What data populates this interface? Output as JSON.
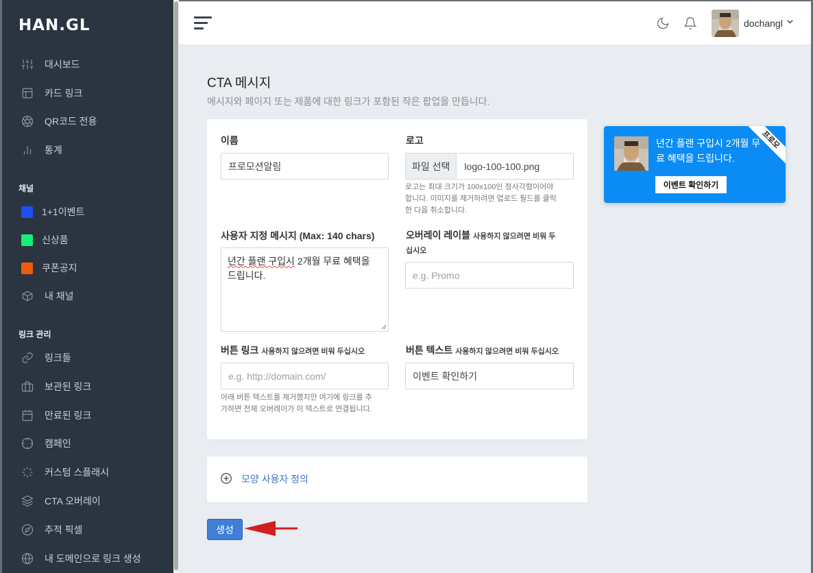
{
  "brand": "HAN.GL",
  "sidebar": {
    "items": [
      {
        "label": "대시보드",
        "icon": "sliders-icon"
      },
      {
        "label": "카드 링크",
        "icon": "layout-icon"
      },
      {
        "label": "QR코드 전용",
        "icon": "aperture-icon"
      },
      {
        "label": "통계",
        "icon": "bar-chart-icon"
      }
    ],
    "channels_title": "채널",
    "channels": [
      {
        "label": "1+1이벤트",
        "color": "#1e4ff5"
      },
      {
        "label": "신상품",
        "color": "#14f07a"
      },
      {
        "label": "쿠폰공지",
        "color": "#f05a0c"
      },
      {
        "label": "내 채널",
        "icon": "box-icon"
      }
    ],
    "links_title": "링크 관리",
    "links": [
      {
        "label": "링크들",
        "icon": "link-icon"
      },
      {
        "label": "보관된 링크",
        "icon": "briefcase-icon"
      },
      {
        "label": "만료된 링크",
        "icon": "calendar-icon"
      },
      {
        "label": "캠페인",
        "icon": "target-icon"
      },
      {
        "label": "커스텀 스플래시",
        "icon": "loader-icon"
      },
      {
        "label": "CTA 오버레이",
        "icon": "layers-icon"
      },
      {
        "label": "추적 픽셀",
        "icon": "compass-icon"
      },
      {
        "label": "내 도메인으로 링크 생성",
        "icon": "globe-icon"
      }
    ]
  },
  "topbar": {
    "username": "dochangl"
  },
  "page": {
    "title": "CTA 메시지",
    "subtitle": "메시지와 페이지 또는 제품에 대한 링크가 포함된 작은 팝업을 만듭니다."
  },
  "form": {
    "name_label": "이름",
    "name_value": "프로모션알림",
    "logo_label": "로고",
    "file_button": "파일 선택",
    "file_name": "logo-100-100.png",
    "logo_help_1": "로고는 최대 크기가 100x100인 정사각형이어야",
    "logo_help_2": "합니다. 이미지를 제거하려면 업로드 필드를 클릭",
    "logo_help_3": "한 다음 취소합니다.",
    "message_label": "사용자 지정 메시지 (Max: 140 chars)",
    "message_part1": "년간 플랜 구입시",
    "message_part2": " 2개월 무료 혜택을",
    "message_part3": "드립니다.",
    "overlay_label": "오버레이 레이블",
    "overlay_hint_1": "사용하지 않으려면 비워 두",
    "overlay_hint_2": "십시오",
    "overlay_placeholder": "e.g. Promo",
    "btn_link_label": "버튼 링크",
    "btn_link_hint": "사용하지 않으려면 비워 두십시오",
    "btn_link_placeholder": "e.g. http://domain.com/",
    "btn_link_help_1": "아래 버튼 텍스트를 제거했지만 여기에 링크를 추",
    "btn_link_help_2": "가하면 전체 오버레이가 이 텍스트로 연결됩니다.",
    "btn_text_label": "버튼 텍스트",
    "btn_text_hint": "사용하지 않으려면 비워 두십시오",
    "btn_text_value": "이벤트 확인하기",
    "customize_label": "모양 사용자 정의",
    "create_button": "생성"
  },
  "preview": {
    "message": "년간 플랜 구입시 2개월 무료 혜택을 드립니다.",
    "button": "이벤트 확인하기",
    "ribbon": "프로모",
    "bg_color": "#0b8cf5"
  }
}
